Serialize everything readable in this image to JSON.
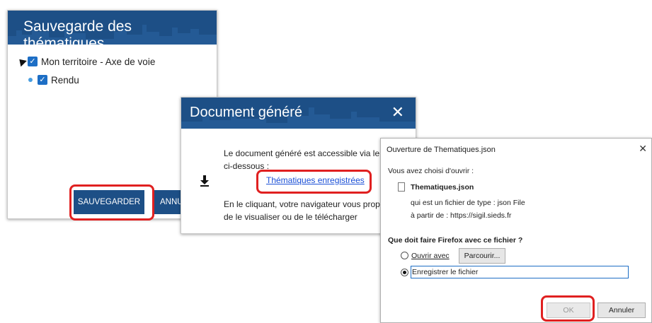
{
  "save_dialog": {
    "title": "Sauvegarde des thématiques",
    "tree": [
      {
        "label": "Mon territoire - Axe de voie"
      },
      {
        "label": "Rendu"
      }
    ],
    "save_label": "SAUVEGARDER",
    "cancel_label": "ANNU"
  },
  "doc_dialog": {
    "title": "Document généré",
    "close": "✕",
    "text1": "Le document généré est accessible via le li",
    "text1b": "ci-dessous :",
    "link": "Thématiques enregistrées",
    "text2": "En le cliquant, votre navigateur vous propos",
    "text2b": "de le visualiser ou de le télécharger"
  },
  "firefox_dialog": {
    "title": "Ouverture de Thematiques.json",
    "close": "✕",
    "intro": "Vous avez choisi d'ouvrir :",
    "filename": "Thematiques.json",
    "type_line": "qui est un fichier de type : json File",
    "from_line": "à partir de : https://sigil.sieds.fr",
    "question": "Que doit faire Firefox avec ce fichier ?",
    "open_with_label": "Ouvrir avec",
    "browse_label": "Parcourir...",
    "save_file_label": "Enregistrer le fichier",
    "ok_label": "OK",
    "cancel_label": "Annuler"
  },
  "colors": {
    "banner": "#1d4f86",
    "highlight": "#e02020",
    "link": "#1a4fd6"
  }
}
